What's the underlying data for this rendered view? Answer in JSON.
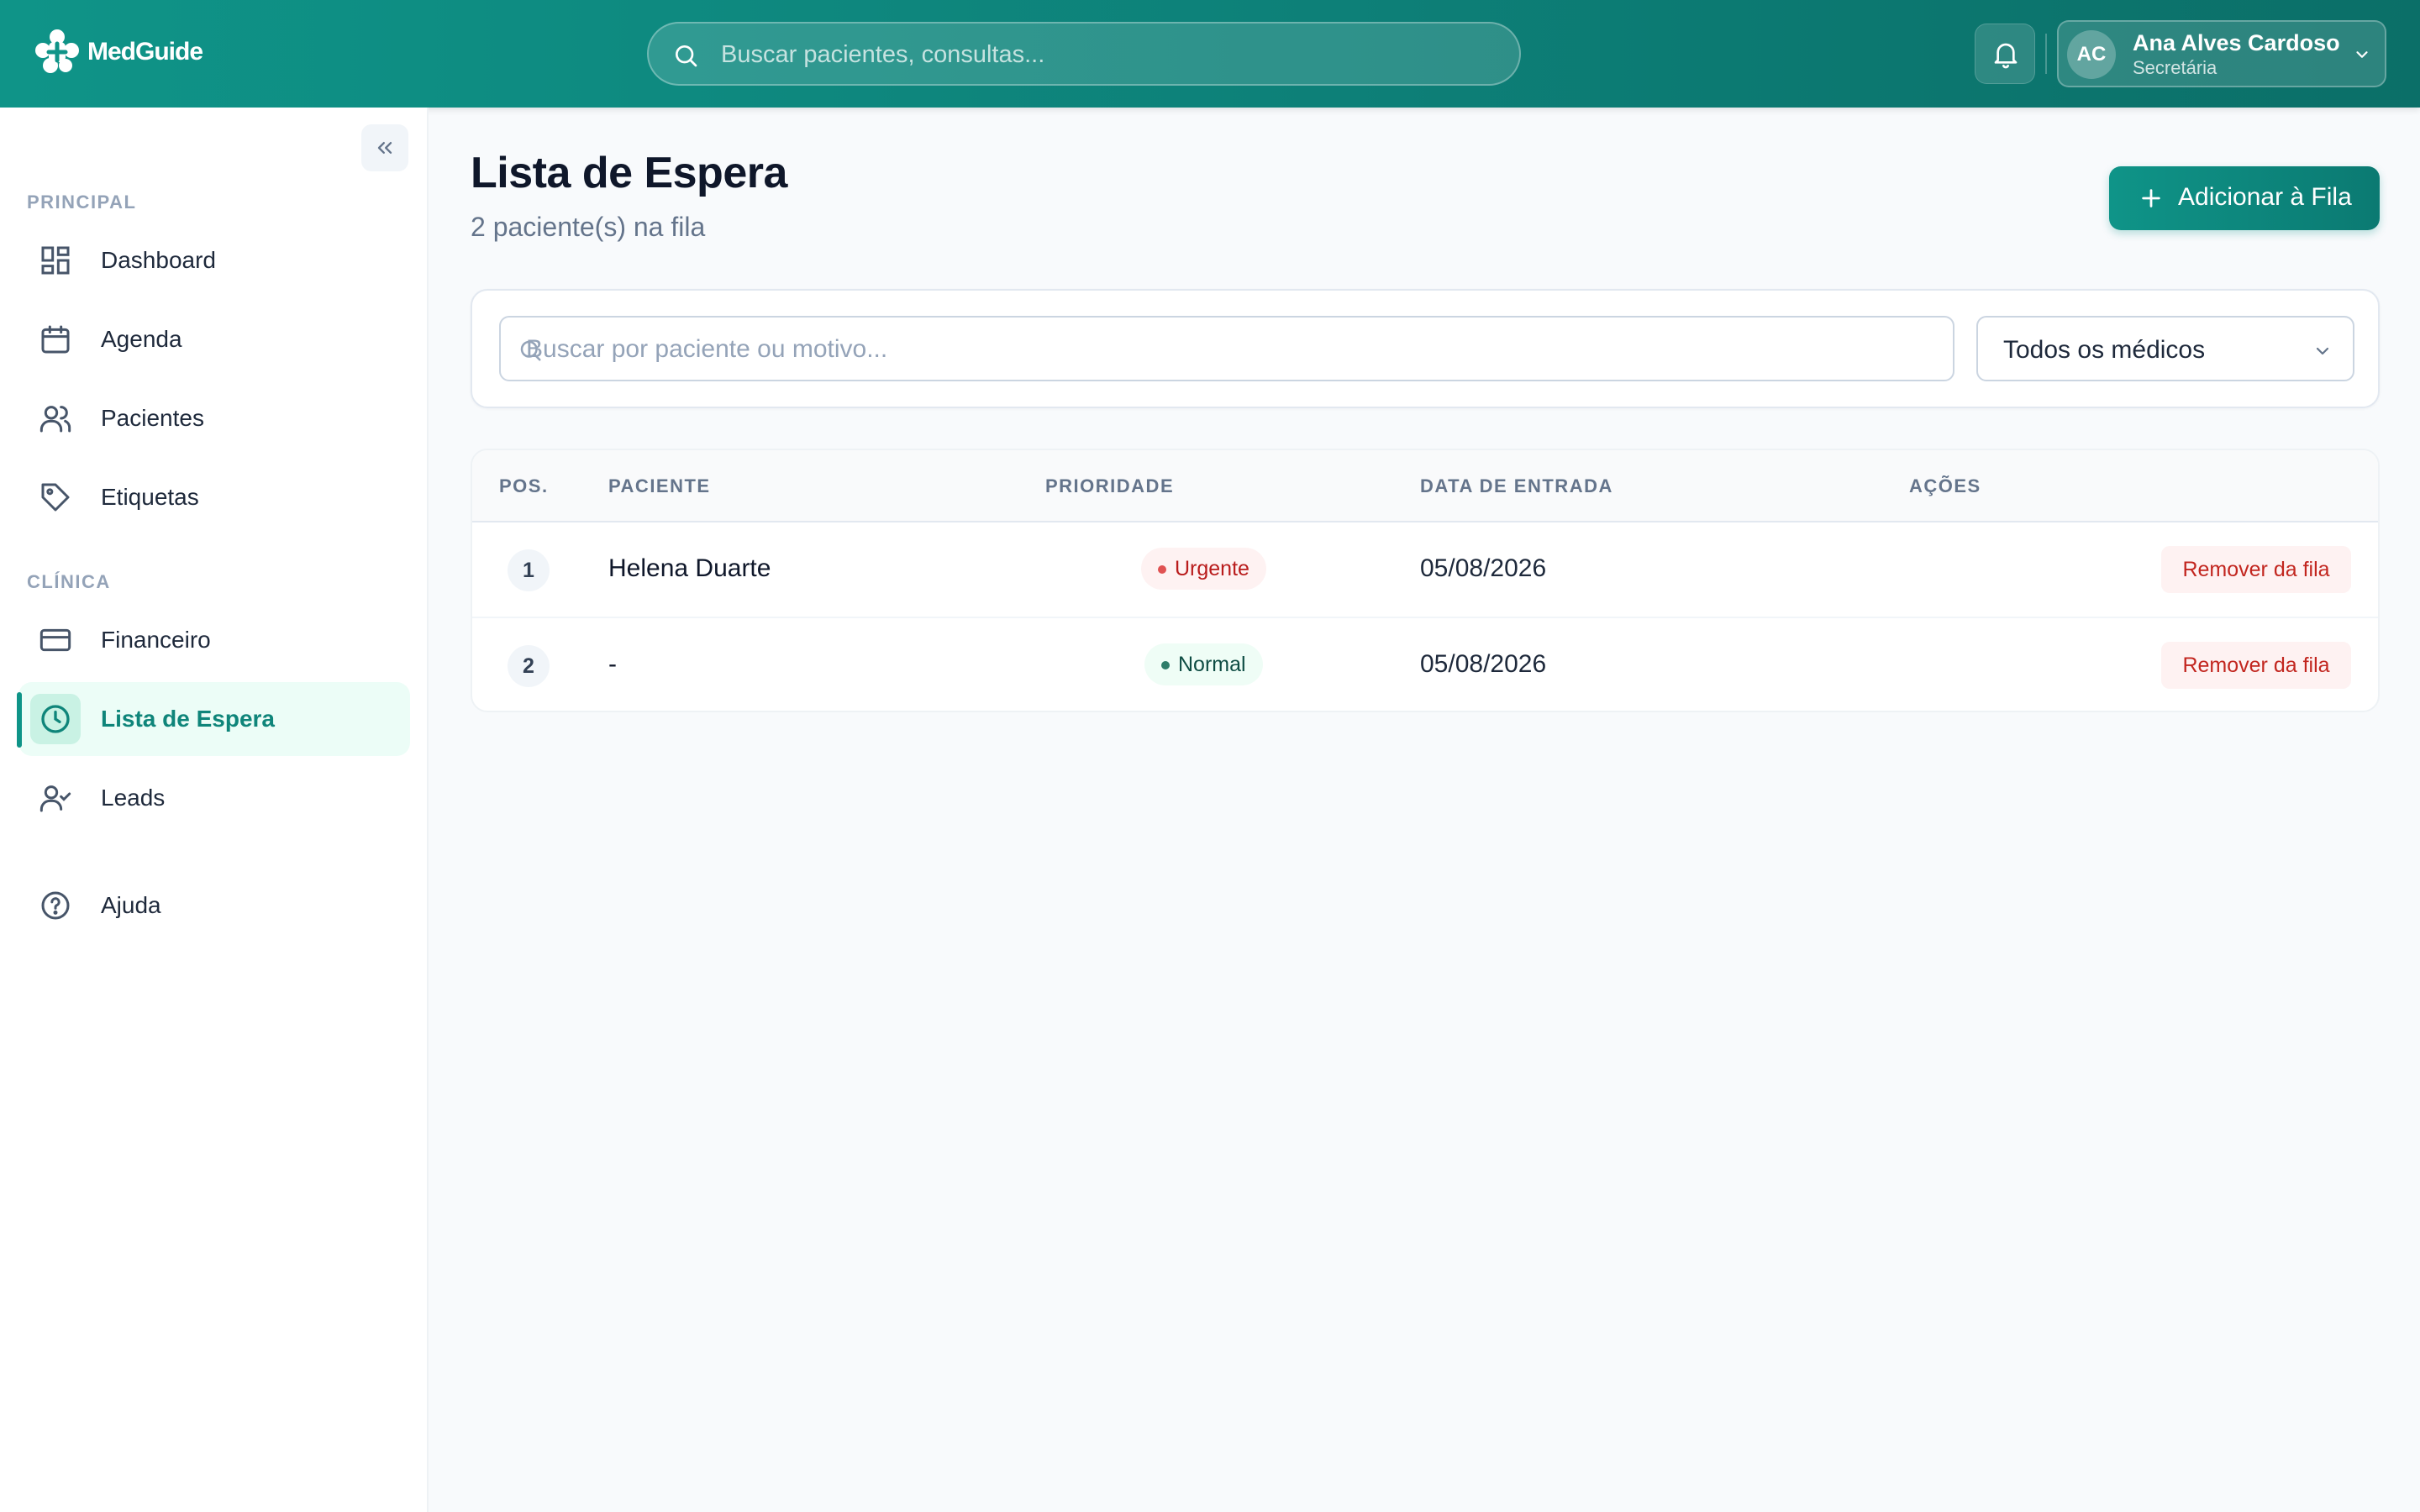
{
  "app": {
    "name": "MedGuide"
  },
  "header": {
    "search_placeholder": "Buscar pacientes, consultas...",
    "user": {
      "initials": "AC",
      "name": "Ana Alves Cardoso",
      "role": "Secretária"
    }
  },
  "sidebar": {
    "sections": [
      {
        "label": "PRINCIPAL"
      },
      {
        "label": "CLÍNICA"
      }
    ],
    "items": [
      {
        "label": "Dashboard",
        "icon": "dashboard-icon"
      },
      {
        "label": "Agenda",
        "icon": "calendar-icon"
      },
      {
        "label": "Pacientes",
        "icon": "users-icon"
      },
      {
        "label": "Etiquetas",
        "icon": "tag-icon"
      },
      {
        "label": "Financeiro",
        "icon": "credit-card-icon"
      },
      {
        "label": "Lista de Espera",
        "icon": "clock-icon",
        "active": true
      },
      {
        "label": "Leads",
        "icon": "user-check-icon"
      },
      {
        "label": "Ajuda",
        "icon": "help-icon"
      }
    ]
  },
  "main": {
    "title": "Lista de Espera",
    "subtitle": "2 paciente(s) na fila",
    "add_button_label": "Adicionar à Fila",
    "filters": {
      "search_placeholder": "Buscar por paciente ou motivo...",
      "doctor_select_value": "Todos os médicos"
    },
    "table": {
      "columns": [
        "POS.",
        "PACIENTE",
        "PRIORIDADE",
        "DATA DE ENTRADA",
        "AÇÕES"
      ],
      "rows": [
        {
          "pos": "1",
          "patient": "Helena Duarte",
          "priority": "Urgente",
          "date": "05/08/2026",
          "action": "Remover da fila"
        },
        {
          "pos": "2",
          "patient": "-",
          "priority": "Normal",
          "date": "05/08/2026",
          "action": "Remover da fila"
        }
      ]
    }
  },
  "colors": {
    "brand": "#0f9488",
    "active_bg": "#ecfdf7",
    "urgent": "#b91c1c",
    "normal": "#0f4d44"
  }
}
